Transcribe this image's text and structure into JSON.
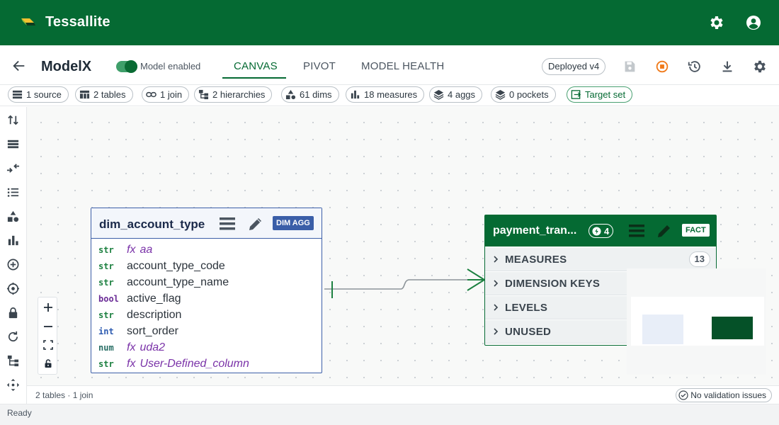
{
  "app": {
    "title": "Tessallite"
  },
  "header": {
    "model_name": "ModelX",
    "toggle_label": "Model enabled",
    "tabs": [
      {
        "label": "CANVAS",
        "active": true
      },
      {
        "label": "PIVOT",
        "active": false
      },
      {
        "label": "MODEL HEALTH",
        "active": false
      }
    ],
    "deployed_label": "Deployed v4"
  },
  "chips": [
    {
      "label": "1 source",
      "icon": "source-icon"
    },
    {
      "label": "2 tables",
      "icon": "table-icon"
    },
    {
      "label": "1 join",
      "icon": "link-icon"
    },
    {
      "label": "2 hierarchies",
      "icon": "hierarchy-icon"
    },
    {
      "label": "61 dims",
      "icon": "shapes-icon"
    },
    {
      "label": "18 measures",
      "icon": "bar-chart-icon"
    },
    {
      "label": "4 aggs",
      "icon": "layers-icon"
    },
    {
      "label": "0 pockets",
      "icon": "layers-icon"
    },
    {
      "label": "Target set",
      "icon": "target-arrow-icon"
    }
  ],
  "dim_table": {
    "name": "dim_account_type",
    "badge": "DIM AGG",
    "columns": [
      {
        "type": "str",
        "name": "aa",
        "calculated": true
      },
      {
        "type": "str",
        "name": "account_type_code",
        "calculated": false
      },
      {
        "type": "str",
        "name": "account_type_name",
        "calculated": false
      },
      {
        "type": "bool",
        "name": "active_flag",
        "calculated": false
      },
      {
        "type": "str",
        "name": "description",
        "calculated": false
      },
      {
        "type": "int",
        "name": "sort_order",
        "calculated": false
      },
      {
        "type": "num",
        "name": "uda2",
        "calculated": true
      },
      {
        "type": "str",
        "name": "User-Defined_column",
        "calculated": true
      }
    ],
    "fx_label": "fx"
  },
  "fact_table": {
    "name": "payment_tran...",
    "count": "4",
    "badge": "FACT",
    "sections": [
      {
        "label": "MEASURES",
        "count": "13"
      },
      {
        "label": "DIMENSION KEYS",
        "count": ""
      },
      {
        "label": "LEVELS",
        "count": ""
      },
      {
        "label": "UNUSED",
        "count": ""
      }
    ]
  },
  "status": {
    "summary": "2 tables · 1 join",
    "validation": "No validation issues",
    "footer": "Ready"
  },
  "colors": {
    "brand": "#056a33",
    "dim_accent": "#3d5fa8",
    "active_indicator": "#f07a1a"
  }
}
